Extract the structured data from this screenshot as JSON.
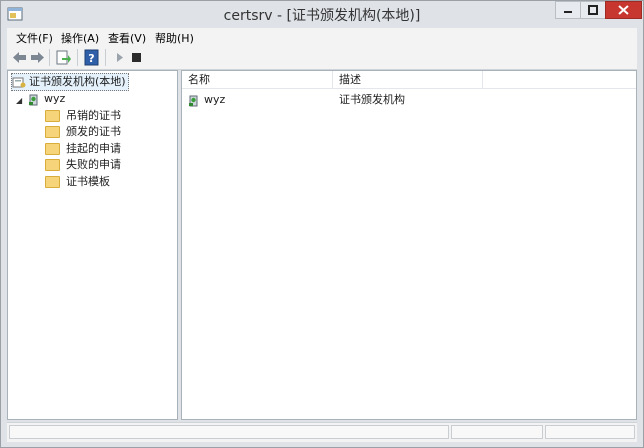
{
  "window": {
    "title": "certsrv - [证书颁发机构(本地)]"
  },
  "menu": [
    "文件(F)",
    "操作(A)",
    "查看(V)",
    "帮助(H)"
  ],
  "toolbar": [
    "back-icon",
    "forward-icon",
    "export-list-icon",
    "help-icon",
    "start-service-icon",
    "stop-service-icon"
  ],
  "tree": {
    "root": "证书颁发机构(本地)",
    "ca": "wyz",
    "folders": [
      "吊销的证书",
      "颁发的证书",
      "挂起的申请",
      "失败的申请",
      "证书模板"
    ]
  },
  "list": {
    "columns": [
      "名称",
      "描述"
    ],
    "rows": [
      {
        "name": "wyz",
        "description": "证书颁发机构"
      }
    ]
  },
  "colors": {
    "chrome": "#dfe3e8",
    "close": "#c7372f",
    "folder": "#f5d47a"
  }
}
